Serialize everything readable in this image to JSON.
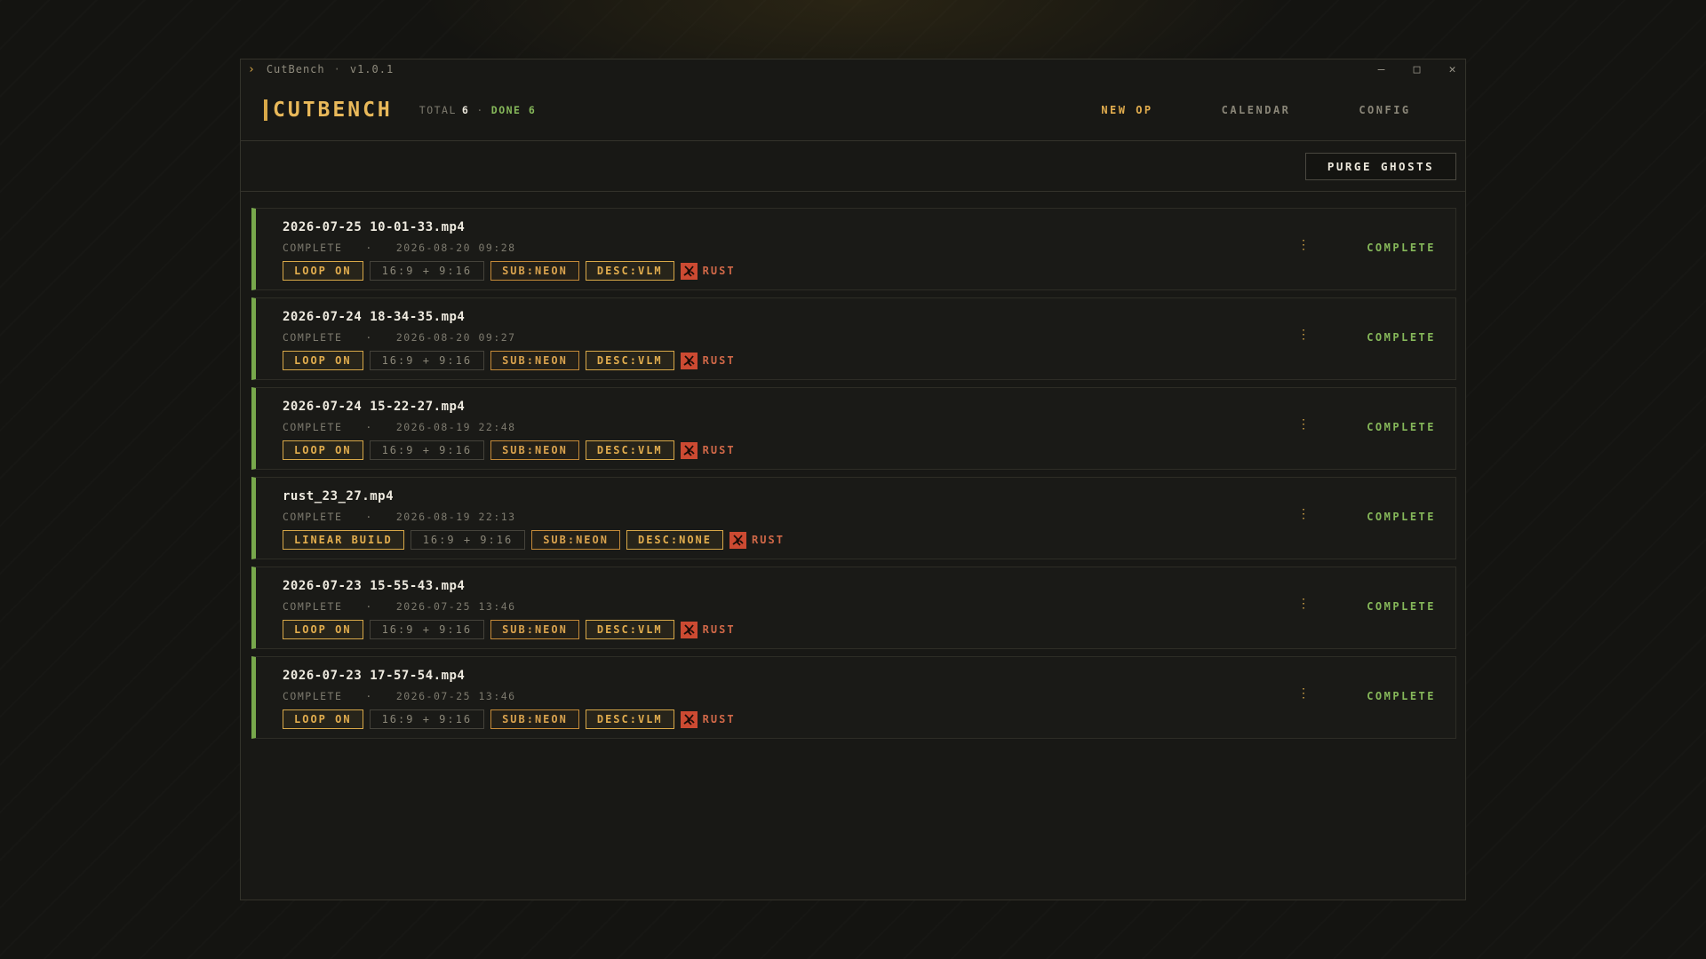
{
  "titlebar": {
    "app": "CutBench",
    "separator": "·",
    "version": "v1.0.1",
    "minimize": "—",
    "maximize": "□",
    "close": "✕"
  },
  "header": {
    "logo": "CUTBENCH",
    "total_label": "TOTAL",
    "total_value": "6",
    "dot": "·",
    "done_label": "DONE 6",
    "nav": [
      "NEW OP",
      "CALENDAR",
      "CONFIG"
    ]
  },
  "toolbar": {
    "purge_label": "PURGE GHOSTS"
  },
  "items": [
    {
      "file": "2026-07-25 10-01-33.mp4",
      "status": "COMPLETE",
      "sep": "·",
      "datetime": "2026-08-20  09:28",
      "mode": "LOOP ON",
      "aspect": "16:9 + 9:16",
      "sub": "SUB:NEON",
      "desc": "DESC:VLM",
      "game": "RUST",
      "badge": "COMPLETE",
      "menu": "⋮"
    },
    {
      "file": "2026-07-24 18-34-35.mp4",
      "status": "COMPLETE",
      "sep": "·",
      "datetime": "2026-08-20  09:27",
      "mode": "LOOP ON",
      "aspect": "16:9 + 9:16",
      "sub": "SUB:NEON",
      "desc": "DESC:VLM",
      "game": "RUST",
      "badge": "COMPLETE",
      "menu": "⋮"
    },
    {
      "file": "2026-07-24 15-22-27.mp4",
      "status": "COMPLETE",
      "sep": "·",
      "datetime": "2026-08-19  22:48",
      "mode": "LOOP ON",
      "aspect": "16:9 + 9:16",
      "sub": "SUB:NEON",
      "desc": "DESC:VLM",
      "game": "RUST",
      "badge": "COMPLETE",
      "menu": "⋮"
    },
    {
      "file": "rust_23_27.mp4",
      "status": "COMPLETE",
      "sep": "·",
      "datetime": "2026-08-19  22:13",
      "mode": "LINEAR BUILD",
      "aspect": "16:9 + 9:16",
      "sub": "SUB:NEON",
      "desc": "DESC:NONE",
      "game": "RUST",
      "badge": "COMPLETE",
      "menu": "⋮"
    },
    {
      "file": "2026-07-23 15-55-43.mp4",
      "status": "COMPLETE",
      "sep": "·",
      "datetime": "2026-07-25  13:46",
      "mode": "LOOP ON",
      "aspect": "16:9 + 9:16",
      "sub": "SUB:NEON",
      "desc": "DESC:VLM",
      "game": "RUST",
      "badge": "COMPLETE",
      "menu": "⋮"
    },
    {
      "file": "2026-07-23 17-57-54.mp4",
      "status": "COMPLETE",
      "sep": "·",
      "datetime": "2026-07-25  13:46",
      "mode": "LOOP ON",
      "aspect": "16:9 + 9:16",
      "sub": "SUB:NEON",
      "desc": "DESC:VLM",
      "game": "RUST",
      "badge": "COMPLETE",
      "menu": "⋮"
    }
  ],
  "colors": {
    "accent": "#e2ad4e",
    "complete": "#86b85a",
    "rust": "#cc4a32"
  },
  "icons": {
    "chevron": "chevron-right-icon",
    "game": "rust-icon",
    "menu": "kebab-menu-icon"
  }
}
